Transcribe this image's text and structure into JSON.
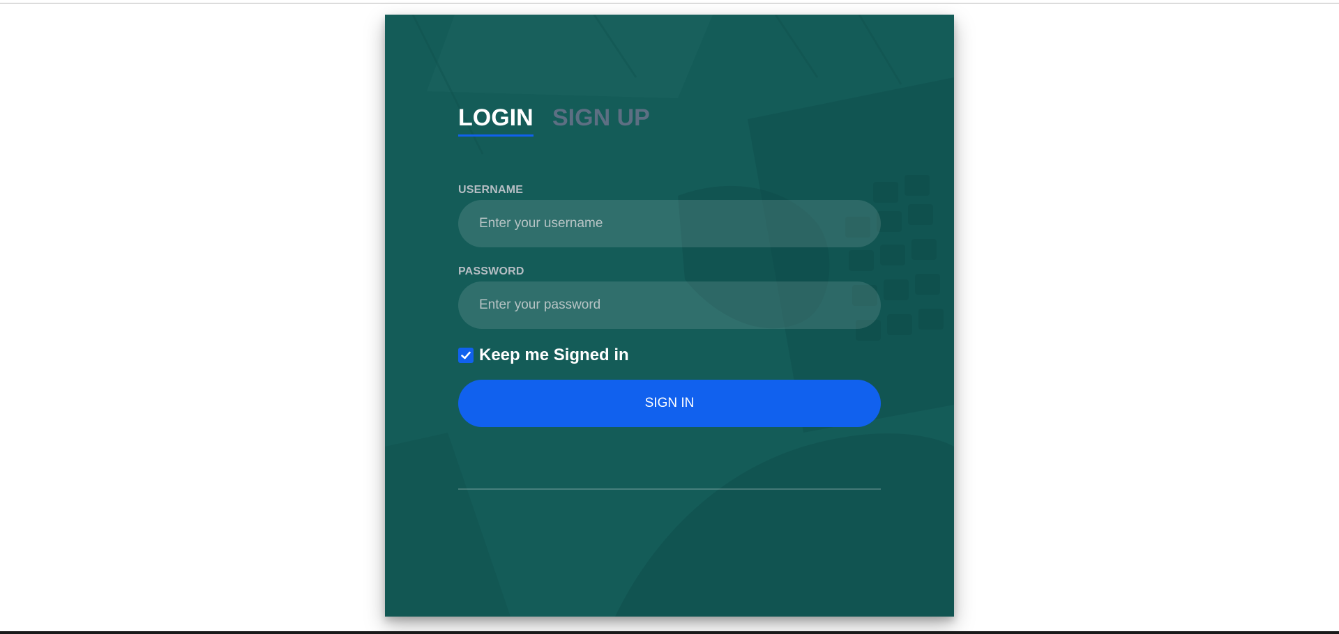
{
  "tabs": {
    "login": "LOGIN",
    "signup": "SIGN UP"
  },
  "form": {
    "username_label": "USERNAME",
    "username_placeholder": "Enter your username",
    "password_label": "PASSWORD",
    "password_placeholder": "Enter your password",
    "keep_signed_in_label": "Keep me Signed in",
    "keep_signed_in_checked": true,
    "signin_label": "SIGN IN"
  },
  "colors": {
    "card_tint": "#155c58",
    "accent": "#1161ee",
    "inactive_tab": "#5d6f83"
  },
  "icons": {
    "checkbox": "checkmark-icon"
  }
}
